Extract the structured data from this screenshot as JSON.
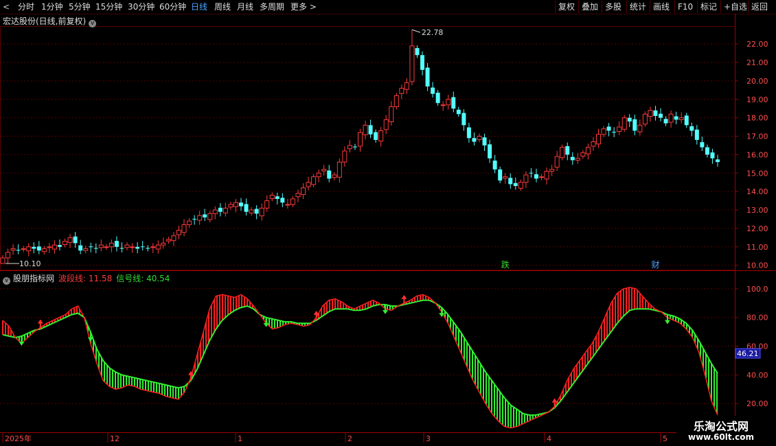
{
  "toolbar": {
    "nav_left": "<",
    "periods": [
      {
        "label": "分时",
        "active": false
      },
      {
        "label": "1分钟",
        "active": false
      },
      {
        "label": "5分钟",
        "active": false
      },
      {
        "label": "15分钟",
        "active": false
      },
      {
        "label": "30分钟",
        "active": false
      },
      {
        "label": "60分钟",
        "active": false
      },
      {
        "label": "日线",
        "active": true
      },
      {
        "label": "周线",
        "active": false
      },
      {
        "label": "月线",
        "active": false
      },
      {
        "label": "多周期",
        "active": false
      },
      {
        "label": "更多 >",
        "active": false
      }
    ],
    "tools": [
      "复权",
      "叠加",
      "多股",
      "统计",
      "画线",
      "F10",
      "标记",
      "+自选",
      "返回"
    ]
  },
  "stock": {
    "title": "宏达股份(日线,前复权)",
    "dropdown_icon": "chevron-down-icon",
    "high_label": "22.78",
    "low_label": "10.10",
    "markers": [
      {
        "text": "跌",
        "color": "#33dd33"
      },
      {
        "text": "财",
        "color": "#4aa3ff"
      }
    ]
  },
  "indicator": {
    "name": "股朋指标网",
    "wave_label": "波段线: 11.58",
    "signal_label": "信号线: 40.54",
    "current_value": "46.21"
  },
  "axes": {
    "price_ticks": [
      "22.00",
      "21.00",
      "20.00",
      "19.00",
      "18.00",
      "17.00",
      "16.00",
      "15.00",
      "14.00",
      "13.00",
      "12.00",
      "11.00",
      "10.00"
    ],
    "indicator_ticks": [
      "100.0",
      "80.00",
      "60.00",
      "40.00",
      "20.00"
    ],
    "date_labels": [
      "2025年",
      "12",
      "1",
      "2",
      "3",
      "4",
      "5"
    ]
  },
  "colors": {
    "up": "#ff3b3b",
    "down": "#54ffff",
    "wave": "#ff2020",
    "signal": "#33ee33",
    "grid": "#5a0000"
  },
  "watermark": {
    "line1": "乐淘公式网",
    "line2": "www.60lt.com"
  },
  "chart_data": [
    {
      "type": "candlestick",
      "title": "宏达股份(日线,前复权)",
      "ylim": [
        9.8,
        22.9
      ],
      "y_ticks": [
        10,
        11,
        12,
        13,
        14,
        15,
        16,
        17,
        18,
        19,
        20,
        21,
        22
      ],
      "high_marker": 22.78,
      "low_marker": 10.1,
      "ohlc_close_estimates": [
        10.4,
        10.7,
        10.9,
        10.8,
        10.9,
        11.0,
        10.9,
        10.8,
        10.9,
        11.0,
        11.1,
        11.0,
        11.3,
        11.5,
        11.2,
        10.8,
        10.9,
        11.0,
        10.9,
        11.1,
        11.0,
        11.2,
        11.0,
        10.9,
        11.1,
        11.0,
        10.9,
        11.0,
        10.9,
        11.0,
        11.1,
        11.2,
        11.4,
        11.6,
        11.9,
        12.2,
        12.4,
        12.5,
        12.7,
        12.6,
        12.8,
        13.0,
        12.9,
        13.1,
        13.3,
        13.4,
        13.2,
        12.9,
        13.0,
        12.8,
        13.1,
        13.5,
        13.8,
        13.6,
        13.4,
        13.3,
        13.6,
        13.9,
        14.2,
        14.5,
        14.8,
        15.0,
        15.2,
        14.7,
        14.9,
        15.6,
        16.2,
        16.5,
        16.4,
        17.2,
        17.6,
        17.1,
        16.8,
        17.3,
        17.9,
        18.6,
        19.2,
        19.6,
        19.9,
        21.9,
        21.4,
        20.6,
        19.7,
        19.3,
        18.8,
        18.7,
        19.0,
        18.5,
        18.2,
        17.6,
        16.9,
        16.7,
        17.0,
        16.5,
        15.8,
        15.2,
        14.6,
        14.8,
        14.4,
        14.3,
        14.5,
        14.9,
        15.0,
        14.7,
        14.8,
        15.1,
        15.2,
        15.9,
        16.4,
        16.0,
        15.7,
        15.8,
        16.1,
        16.4,
        16.7,
        17.1,
        17.4,
        17.3,
        17.2,
        17.5,
        18.0,
        17.8,
        17.3,
        17.6,
        18.2,
        18.4,
        18.1,
        18.0,
        17.7,
        18.2,
        17.9,
        18.0,
        17.6,
        17.3,
        16.8,
        16.4,
        16.0,
        15.8,
        15.6
      ]
    },
    {
      "type": "line",
      "title": "股朋指标网",
      "ylim": [
        0,
        110
      ],
      "y_ticks": [
        20,
        40,
        60,
        80,
        100
      ],
      "series": [
        {
          "name": "波段线",
          "last_value": 11.58,
          "values": [
            78,
            74,
            66,
            62,
            66,
            70,
            73,
            76,
            78,
            80,
            82,
            86,
            88,
            80,
            62,
            48,
            36,
            32,
            30,
            31,
            33,
            32,
            30,
            29,
            28,
            27,
            25,
            24,
            23,
            28,
            38,
            54,
            70,
            86,
            95,
            96,
            95,
            94,
            96,
            93,
            88,
            82,
            76,
            72,
            73,
            75,
            76,
            75,
            74,
            75,
            80,
            88,
            92,
            93,
            91,
            88,
            86,
            88,
            90,
            92,
            90,
            86,
            85,
            88,
            90,
            92,
            95,
            96,
            94,
            90,
            84,
            76,
            66,
            56,
            46,
            36,
            28,
            20,
            13,
            8,
            4,
            3,
            4,
            6,
            8,
            10,
            12,
            14,
            18,
            26,
            36,
            44,
            50,
            56,
            62,
            70,
            80,
            90,
            97,
            100,
            101,
            100,
            95,
            90,
            86,
            84,
            80,
            78,
            76,
            72,
            66,
            56,
            40,
            22,
            12
          ]
        },
        {
          "name": "信号线",
          "last_value": 40.54,
          "values": [
            68,
            67,
            66,
            67,
            69,
            71,
            72,
            74,
            76,
            78,
            80,
            82,
            83,
            80,
            70,
            58,
            50,
            45,
            42,
            40,
            39,
            38,
            37,
            36,
            35,
            34,
            33,
            32,
            31,
            32,
            36,
            44,
            54,
            64,
            72,
            78,
            82,
            85,
            87,
            88,
            86,
            82,
            80,
            79,
            78,
            77,
            77,
            76,
            76,
            76,
            78,
            81,
            84,
            86,
            86,
            86,
            85,
            85,
            86,
            88,
            89,
            89,
            88,
            88,
            89,
            90,
            91,
            92,
            92,
            90,
            87,
            82,
            76,
            70,
            63,
            56,
            49,
            42,
            36,
            30,
            24,
            19,
            16,
            13,
            12,
            12,
            13,
            14,
            17,
            22,
            28,
            34,
            40,
            46,
            52,
            58,
            64,
            70,
            76,
            81,
            85,
            86,
            86,
            86,
            85,
            84,
            82,
            81,
            79,
            76,
            71,
            64,
            56,
            48,
            41
          ]
        }
      ]
    }
  ]
}
